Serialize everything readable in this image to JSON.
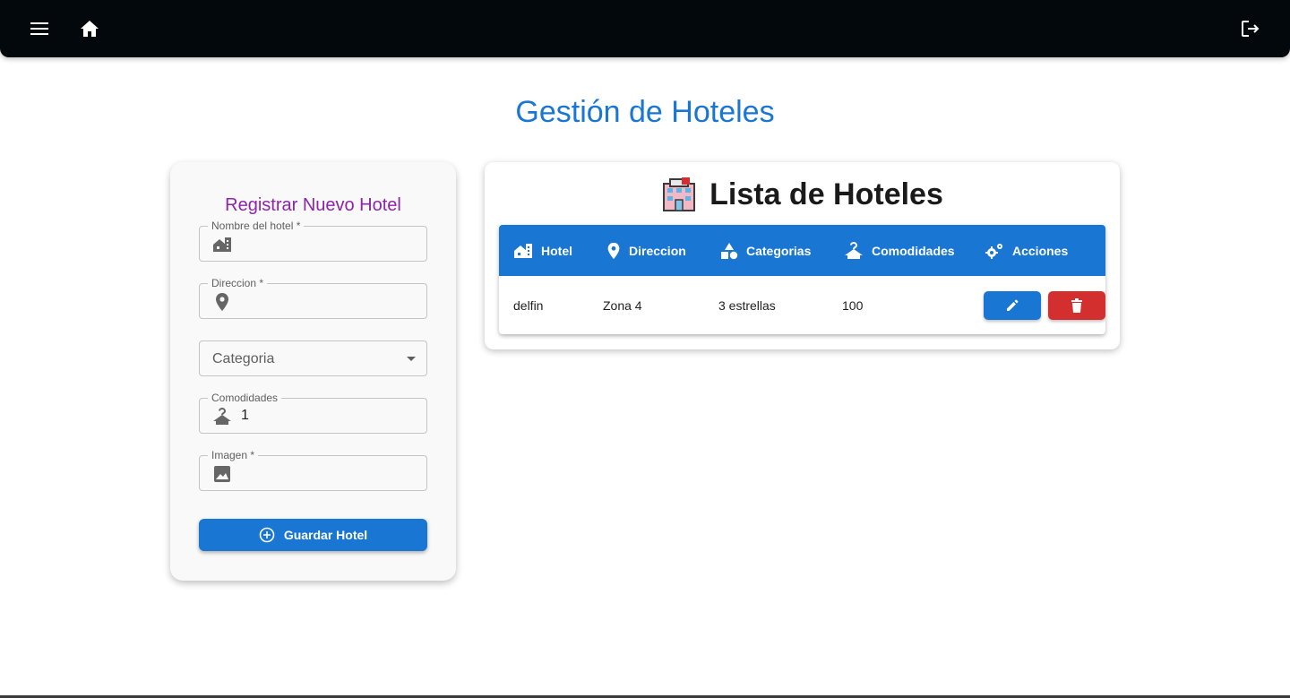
{
  "page": {
    "title": "Gestión de Hoteles"
  },
  "appbar": {
    "menu_icon": "menu-icon",
    "home_icon": "home-icon",
    "logout_icon": "logout-icon"
  },
  "form": {
    "title": "Registrar Nuevo Hotel",
    "fields": {
      "nombre": {
        "label": "Nombre del hotel *",
        "value": "",
        "icon": "hotel-building-icon"
      },
      "direccion": {
        "label": "Direccion *",
        "value": "",
        "icon": "location-pin-icon"
      },
      "categoria": {
        "placeholder": "Categoria",
        "icon": "chevron-down-icon"
      },
      "comodidades": {
        "label": "Comodidades",
        "value": "1",
        "icon": "hanger-icon"
      },
      "imagen": {
        "label": "Imagen *",
        "value": "",
        "icon": "image-icon"
      }
    },
    "save_button": {
      "label": "Guardar Hotel",
      "icon": "add-circle-icon"
    }
  },
  "list": {
    "title": "Lista de Hoteles",
    "title_icon": "hotel-emoji-icon",
    "columns": [
      {
        "label": "Hotel",
        "icon": "hotel-building-icon"
      },
      {
        "label": "Direccion",
        "icon": "location-pin-icon"
      },
      {
        "label": "Categorias",
        "icon": "category-shapes-icon"
      },
      {
        "label": "Comodidades",
        "icon": "hanger-icon"
      },
      {
        "label": "Acciones",
        "icon": "settings-gears-icon"
      }
    ],
    "rows": [
      {
        "hotel": "delfin",
        "direccion": "Zona 4",
        "categoria": "3 estrellas",
        "comodidades": "100"
      }
    ],
    "actions": {
      "edit_icon": "edit-pencil-icon",
      "delete_icon": "delete-trash-icon"
    }
  },
  "colors": {
    "primary": "#1976d2",
    "danger": "#d32f2f",
    "form_title": "#8e24aa",
    "appbar": "#03080c"
  }
}
